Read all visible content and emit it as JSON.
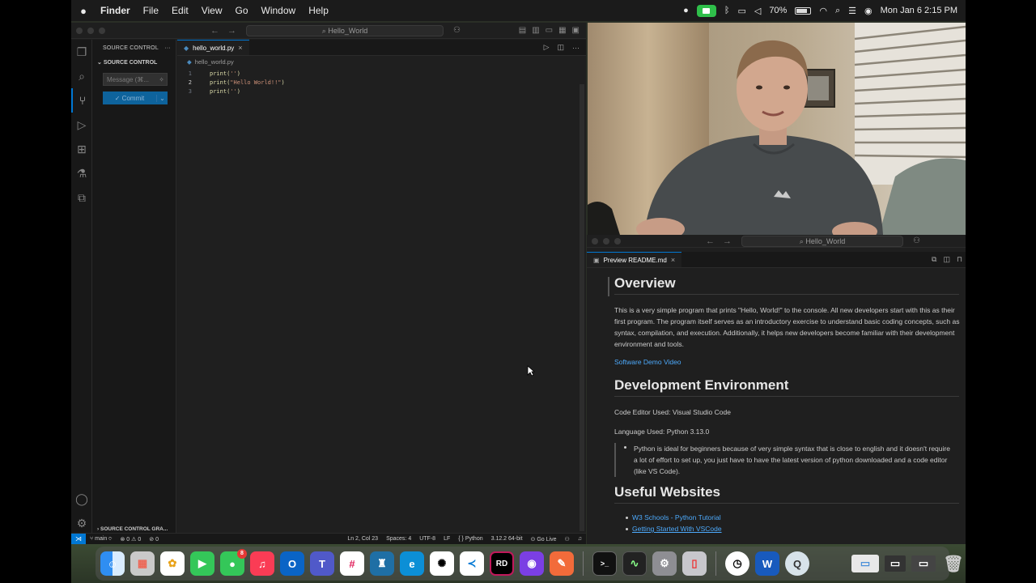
{
  "menubar": {
    "apple": "",
    "items": [
      "Finder",
      "File",
      "Edit",
      "View",
      "Go",
      "Window",
      "Help"
    ],
    "battery": "70%",
    "clock": "Mon Jan 6  2:15 PM"
  },
  "vscode_left": {
    "search": "Hello_World",
    "sidebar": {
      "title": "SOURCE CONTROL",
      "section": "SOURCE CONTROL",
      "message_placeholder": "Message (⌘...",
      "commit_label": "✓ Commit",
      "graph": "SOURCE CONTROL GRA..."
    },
    "tab_label": "hello_world.py",
    "breadcrumb": "hello_world.py",
    "code": [
      {
        "n": "1",
        "text_a": "print(",
        "str": "''",
        "text_b": ")"
      },
      {
        "n": "2",
        "text_a": "print(",
        "str": "\"Hello World!!\"",
        "text_b": ")"
      },
      {
        "n": "3",
        "text_a": "print(",
        "str": "''",
        "text_b": ")"
      }
    ],
    "status": {
      "branch": "main",
      "errors": "⊗ 0 ⚠ 0",
      "ports": "⊘ 0",
      "position": "Ln 2, Col 23",
      "spaces": "Spaces: 4",
      "encoding": "UTF-8",
      "eol": "LF",
      "lang": "Python",
      "interpreter": "3.12.2 64-bit",
      "golive": "Go Live"
    }
  },
  "vscode_right": {
    "search": "Hello_World",
    "tab_label": "Preview README.md",
    "readme": {
      "h_overview": "Overview",
      "p_overview": "This is a very simple program that prints \"Hello, World!\" to the console. All new developers start with this as their first program. The program itself serves as an introductory exercise to understand basic coding concepts, such as syntax, compilation, and execution. Additionally, it helps new developers become familiar with their development environment and tools.",
      "demo_link": "Software Demo Video",
      "h_env": "Development Environment",
      "editor_used": "Code Editor Used: Visual Studio Code",
      "lang_used": "Language Used: Python 3.13.0",
      "quote": "Python is ideal for beginners because of very simple syntax that is close to english and it doesn't require a lot of effort to set up, you just have to have the latest version of python downloaded and a code editor (like VS Code).",
      "h_sites": "Useful Websites",
      "sites": [
        "W3 Schools - Python Tutorial",
        "Getting Started With VSCode"
      ]
    }
  },
  "dock": {
    "messages_badge": "8",
    "rider_label": "RD"
  }
}
